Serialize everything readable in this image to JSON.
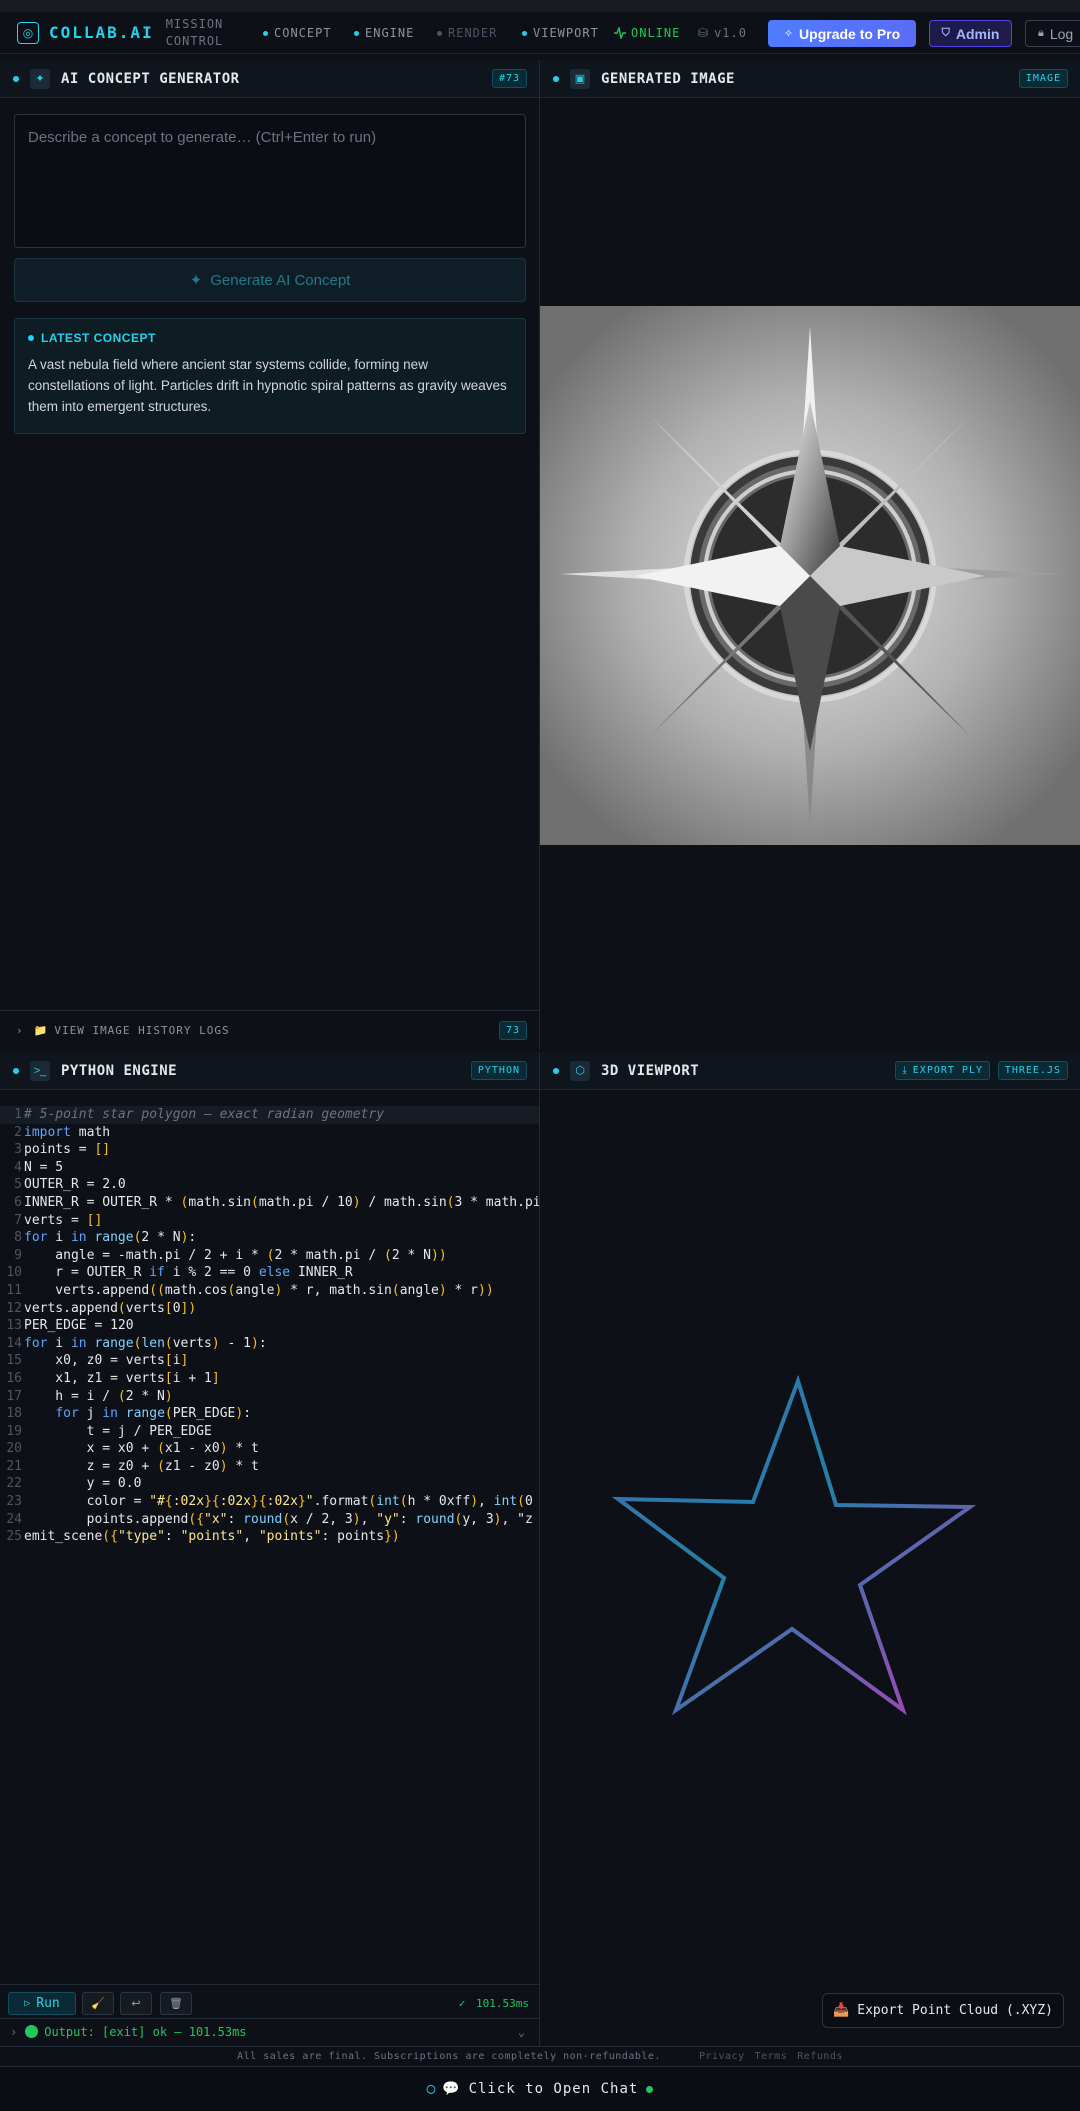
{
  "nav": {
    "brand": "COLLAB.AI",
    "brand_sub_1": "MISSION",
    "brand_sub_2": "CONTROL",
    "tabs": [
      {
        "label": "CONCEPT"
      },
      {
        "label": "ENGINE"
      },
      {
        "label": "RENDER"
      },
      {
        "label": "VIEWPORT"
      }
    ],
    "status": "ONLINE",
    "version": "v1.0",
    "upgrade": "Upgrade to Pro",
    "admin": "Admin",
    "login": "Log"
  },
  "concept_panel": {
    "title": "AI CONCEPT GENERATOR",
    "badge": "#73",
    "placeholder": "Describe a concept to generate… (Ctrl+Enter to run)",
    "generate_label": "Generate AI Concept",
    "latest_title": "LATEST CONCEPT",
    "latest_text": "A vast nebula field where ancient star systems collide, forming new constellations of light. Particles drift in hypnotic spiral patterns as gravity weaves them into emergent structures.",
    "history_label": "VIEW IMAGE HISTORY LOGS",
    "history_count": "73"
  },
  "image_panel": {
    "title": "GENERATED IMAGE",
    "badge": "IMAGE"
  },
  "engine_panel": {
    "title": "PYTHON ENGINE",
    "badge": "PYTHON",
    "code_lines": [
      "# 5-point star polygon — exact radian geometry",
      "import math",
      "points = []",
      "N = 5",
      "OUTER_R = 2.0",
      "INNER_R = OUTER_R * (math.sin(math.pi / 10) / math.sin(3 * math.pi",
      "verts = []",
      "for i in range(2 * N):",
      "    angle = -math.pi / 2 + i * (2 * math.pi / (2 * N))",
      "    r = OUTER_R if i % 2 == 0 else INNER_R",
      "    verts.append((math.cos(angle) * r, math.sin(angle) * r))",
      "verts.append(verts[0])",
      "PER_EDGE = 120",
      "for i in range(len(verts) - 1):",
      "    x0, z0 = verts[i]",
      "    x1, z1 = verts[i + 1]",
      "    h = i / (2 * N)",
      "    for j in range(PER_EDGE):",
      "        t = j / PER_EDGE",
      "        x = x0 + (x1 - x0) * t",
      "        z = z0 + (z1 - z0) * t",
      "        y = 0.0",
      "        color = \"#{:02x}{:02x}{:02x}\".format(int(h * 0xff), int(0",
      "        points.append({\"x\": round(x / 2, 3), \"y\": round(y, 3), \"z",
      "emit_scene({\"type\": \"points\", \"points\": points})"
    ],
    "run_label": "Run",
    "timer": "101.53ms",
    "output": "Output: [exit] ok — 101.53ms"
  },
  "viewport_panel": {
    "title": "3D VIEWPORT",
    "export_ply": "EXPORT PLY",
    "badge": "THREE.JS",
    "export_cloud": "Export Point Cloud (.XYZ)"
  },
  "footer": {
    "notice": "All sales are final. Subscriptions are completely non-refundable.",
    "links": [
      "Privacy",
      "Terms",
      "Refunds"
    ],
    "chat": "Click to Open Chat"
  },
  "colors": {
    "accent": "#22d3ee",
    "online": "#22c55e",
    "pro": "#4f7cff",
    "star_start": "#1f8fb0",
    "star_end": "#a33fb5"
  }
}
